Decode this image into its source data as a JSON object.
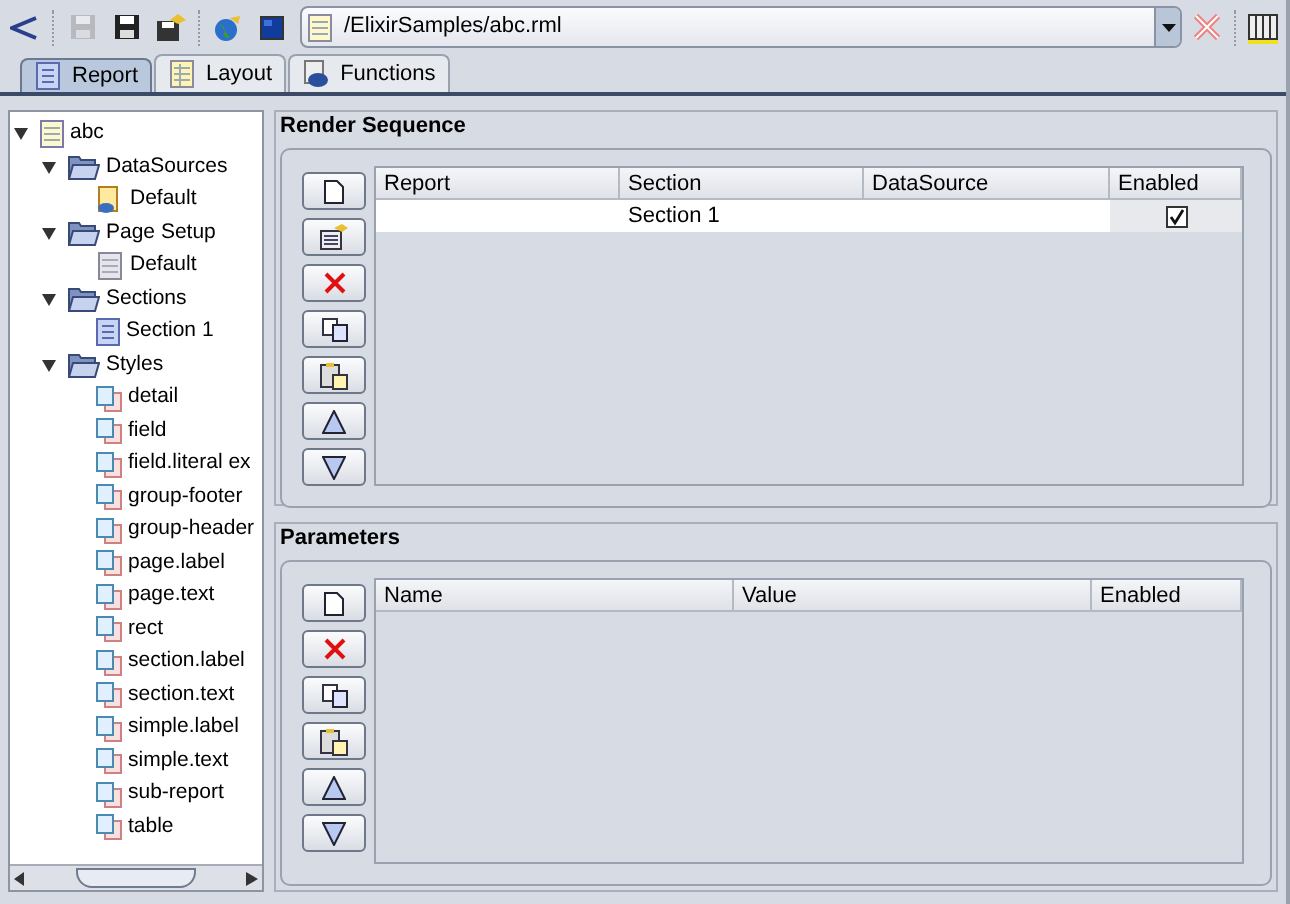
{
  "toolbar": {
    "path": "/ElixirSamples/abc.rml",
    "buttons": [
      {
        "kind": "back",
        "disabled": false
      },
      {
        "kind": "save",
        "disabled": true
      },
      {
        "kind": "save",
        "disabled": false
      },
      {
        "kind": "saveas",
        "disabled": false
      },
      {
        "kind": "globe",
        "disabled": false
      },
      {
        "kind": "square",
        "disabled": false
      }
    ]
  },
  "tabs": [
    {
      "label": "Report",
      "selected": true,
      "kind": "report"
    },
    {
      "label": "Layout",
      "selected": false,
      "kind": "layout"
    },
    {
      "label": "Functions",
      "selected": false,
      "kind": "functions"
    }
  ],
  "tree": [
    {
      "label": "abc",
      "kind": "file",
      "expanded": true,
      "children": [
        {
          "label": "DataSources",
          "kind": "folder",
          "expanded": true,
          "children": [
            {
              "label": "Default",
              "kind": "datasource"
            }
          ]
        },
        {
          "label": "Page Setup",
          "kind": "folder",
          "expanded": true,
          "children": [
            {
              "label": "Default",
              "kind": "page"
            }
          ]
        },
        {
          "label": "Sections",
          "kind": "folder",
          "expanded": true,
          "children": [
            {
              "label": "Section 1",
              "kind": "section"
            }
          ]
        },
        {
          "label": "Styles",
          "kind": "folder",
          "expanded": true,
          "children": [
            {
              "label": "detail",
              "kind": "style"
            },
            {
              "label": "field",
              "kind": "style"
            },
            {
              "label": "field.literal ex",
              "kind": "style"
            },
            {
              "label": "group-footer",
              "kind": "style"
            },
            {
              "label": "group-header",
              "kind": "style"
            },
            {
              "label": "page.label",
              "kind": "style"
            },
            {
              "label": "page.text",
              "kind": "style"
            },
            {
              "label": "rect",
              "kind": "style"
            },
            {
              "label": "section.label",
              "kind": "style"
            },
            {
              "label": "section.text",
              "kind": "style"
            },
            {
              "label": "simple.label",
              "kind": "style"
            },
            {
              "label": "simple.text",
              "kind": "style"
            },
            {
              "label": "sub-report",
              "kind": "style"
            },
            {
              "label": "table",
              "kind": "style"
            }
          ]
        }
      ]
    }
  ],
  "render_sequence": {
    "title": "Render Sequence",
    "buttons": [
      {
        "kind": "new"
      },
      {
        "kind": "properties"
      },
      {
        "kind": "delete"
      },
      {
        "kind": "copy"
      },
      {
        "kind": "paste"
      },
      {
        "kind": "up"
      },
      {
        "kind": "down"
      }
    ],
    "columns": [
      "Report",
      "Section",
      "DataSource",
      "Enabled"
    ],
    "rows": [
      {
        "report": "",
        "section": "Section 1",
        "datasource": "",
        "enabled": true
      }
    ]
  },
  "parameters": {
    "title": "Parameters",
    "buttons": [
      {
        "kind": "new"
      },
      {
        "kind": "delete"
      },
      {
        "kind": "copy"
      },
      {
        "kind": "paste"
      },
      {
        "kind": "up"
      },
      {
        "kind": "down"
      }
    ],
    "columns": [
      "Name",
      "Value",
      "Enabled"
    ]
  }
}
